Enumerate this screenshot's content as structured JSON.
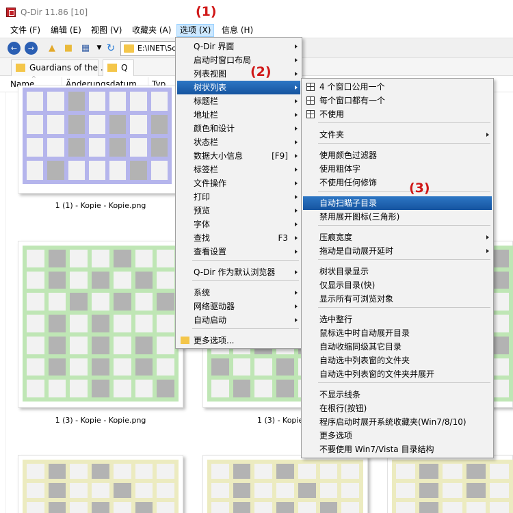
{
  "window": {
    "title": "Q-Dir 11.86 [10]"
  },
  "menubar": [
    {
      "label": "文件 (F)",
      "active": false
    },
    {
      "label": "编辑 (E)",
      "active": false
    },
    {
      "label": "视图 (V)",
      "active": false
    },
    {
      "label": "收藏夹 (A)",
      "active": false
    },
    {
      "label": "选项 (X)",
      "active": true
    },
    {
      "label": "信息 (H)",
      "active": false
    }
  ],
  "toolbar": {
    "address": "E:\\INET\\So"
  },
  "tabs": [
    {
      "label": "Guardians of the ...",
      "active": false
    },
    {
      "label": "Q",
      "active": true
    }
  ],
  "columns": [
    "Name",
    "Änderungsdatum",
    "Typ"
  ],
  "files": [
    {
      "caption": "1 (1) - Kopie - Kopie.png",
      "color": "#b5b5ec"
    },
    {
      "caption": "1 (3) - Kopie - Kopie.png",
      "color": "#bfe6b5"
    },
    {
      "caption": "1 (3) - Kopie",
      "color": "#bfe6b5"
    },
    {
      "caption": "",
      "color": "#ecebc0"
    }
  ],
  "annotations": [
    "(1)",
    "(2)",
    "(3)"
  ],
  "options_menu": {
    "items": [
      {
        "label": "Q-Dir 界面",
        "shortcut": "",
        "arrow": true
      },
      {
        "label": "启动时窗口布局",
        "shortcut": "",
        "arrow": true
      },
      {
        "label": "列表视图",
        "shortcut": "",
        "arrow": true
      },
      {
        "label": "树状列表",
        "shortcut": "",
        "arrow": true,
        "selected": true
      },
      {
        "label": "标题栏",
        "shortcut": "",
        "arrow": true
      },
      {
        "label": "地址栏",
        "shortcut": "",
        "arrow": true
      },
      {
        "label": "颜色和设计",
        "shortcut": "",
        "arrow": true
      },
      {
        "label": "状态栏",
        "shortcut": "",
        "arrow": true
      },
      {
        "label": "数据大小信息",
        "shortcut": "[F9]",
        "arrow": true
      },
      {
        "label": "标签栏",
        "shortcut": "",
        "arrow": true
      },
      {
        "label": "文件操作",
        "shortcut": "",
        "arrow": true
      },
      {
        "label": "打印",
        "shortcut": "",
        "arrow": true
      },
      {
        "label": "预览",
        "shortcut": "",
        "arrow": true
      },
      {
        "label": "字体",
        "shortcut": "",
        "arrow": true
      },
      {
        "label": "查找",
        "shortcut": "F3",
        "arrow": true
      },
      {
        "label": "查看设置",
        "shortcut": "",
        "arrow": true
      },
      {
        "label": "Q-Dir 作为默认浏览器",
        "shortcut": "",
        "arrow": true
      },
      {
        "label": "系统",
        "shortcut": "",
        "arrow": true
      },
      {
        "label": "网络驱动器",
        "shortcut": "",
        "arrow": true
      },
      {
        "label": "自动启动",
        "shortcut": "",
        "arrow": true
      },
      {
        "label": "更多选项...",
        "shortcut": "",
        "arrow": false
      }
    ]
  },
  "tree_submenu": {
    "items": [
      {
        "label": "4 个窗口公用一个",
        "arrow": false
      },
      {
        "label": "每个窗口都有一个",
        "arrow": false
      },
      {
        "label": "不使用",
        "arrow": false
      },
      {
        "label": "文件夹",
        "arrow": true
      },
      {
        "label": "使用颜色过滤器",
        "arrow": false
      },
      {
        "label": "使用粗体字",
        "arrow": false
      },
      {
        "label": "不使用任何修饰",
        "arrow": false
      },
      {
        "label": "自动扫瞄子目录",
        "arrow": false,
        "selected": true
      },
      {
        "label": "禁用展开图标(三角形)",
        "arrow": false
      },
      {
        "label": "压痕宽度",
        "arrow": true
      },
      {
        "label": "拖动是自动展开延时",
        "arrow": true
      },
      {
        "label": "树状目录显示",
        "arrow": false
      },
      {
        "label": "仅显示目录(快)",
        "arrow": false
      },
      {
        "label": "显示所有可浏览对象",
        "arrow": false
      },
      {
        "label": "选中整行",
        "arrow": false
      },
      {
        "label": "鼠标选中时自动展开目录",
        "arrow": false
      },
      {
        "label": "自动收缩同级其它目录",
        "arrow": false
      },
      {
        "label": "自动选中列表窗的文件夹",
        "arrow": false
      },
      {
        "label": "自动选中列表窗的文件夹并展开",
        "arrow": false
      },
      {
        "label": "不显示线条",
        "arrow": false
      },
      {
        "label": "在根行(按钮)",
        "arrow": false
      },
      {
        "label": "程序启动时展开系统收藏夹(Win7/8/10)",
        "arrow": false
      },
      {
        "label": "更多选项",
        "arrow": false
      },
      {
        "label": "不要使用 Win7/Vista 目录结构",
        "arrow": false
      }
    ]
  }
}
